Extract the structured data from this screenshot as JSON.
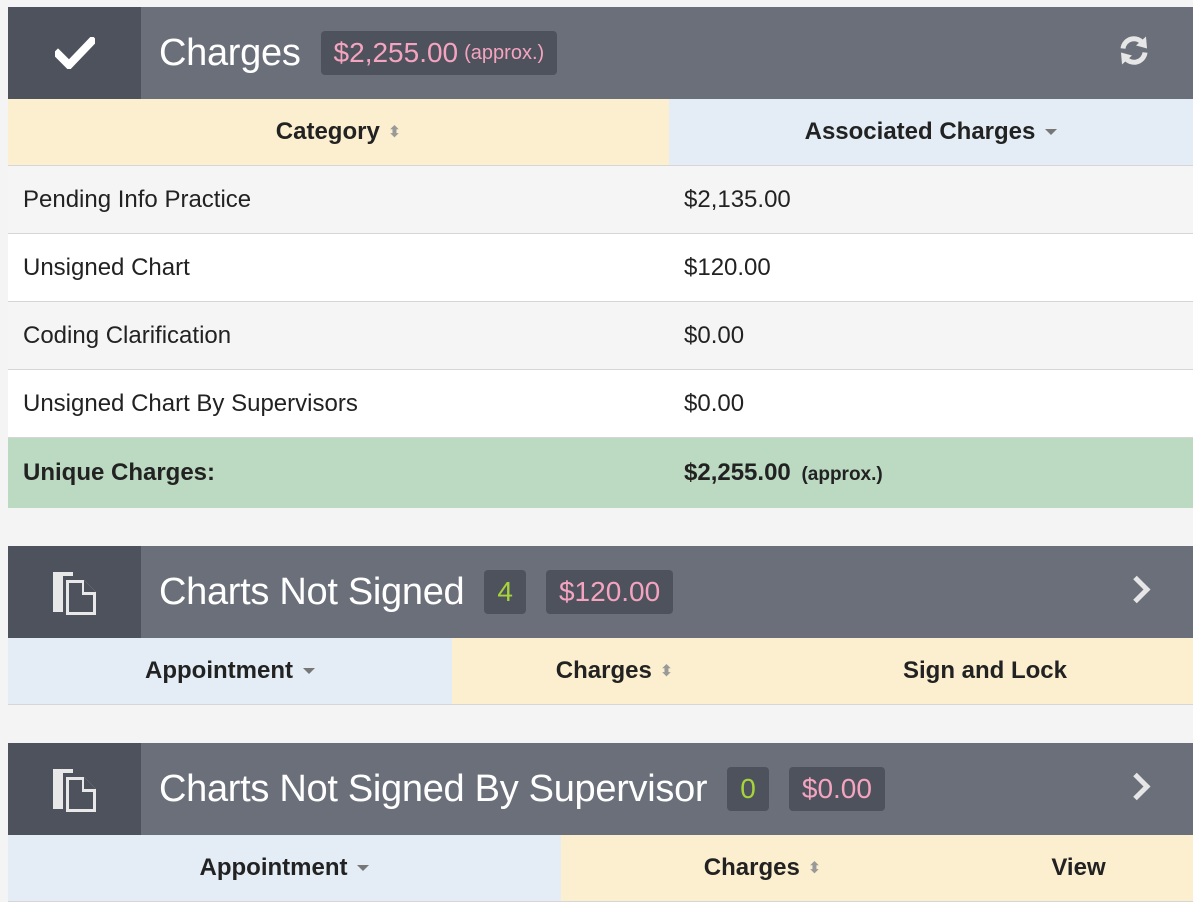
{
  "charges_panel": {
    "title": "Charges",
    "badge_amount": "$2,255.00",
    "badge_approx": "(approx.)",
    "col_category": "Category",
    "col_associated": "Associated Charges",
    "rows": [
      {
        "category": "Pending Info Practice",
        "amount": "$2,135.00"
      },
      {
        "category": "Unsigned Chart",
        "amount": "$120.00"
      },
      {
        "category": "Coding Clarification",
        "amount": "$0.00"
      },
      {
        "category": "Unsigned Chart By Supervisors",
        "amount": "$0.00"
      }
    ],
    "total_label": "Unique Charges:",
    "total_amount": "$2,255.00",
    "total_approx": "(approx.)"
  },
  "charts_not_signed": {
    "title": "Charts Not Signed",
    "count": "4",
    "amount": "$120.00",
    "col_appointment": "Appointment",
    "col_charges": "Charges",
    "col_action": "Sign and Lock"
  },
  "charts_not_signed_supervisor": {
    "title": "Charts Not Signed By Supervisor",
    "count": "0",
    "amount": "$0.00",
    "col_appointment": "Appointment",
    "col_charges": "Charges",
    "col_action": "View"
  },
  "icons": {
    "charges": "check-icon",
    "refresh": "refresh-icon",
    "documents": "documents-icon",
    "expand": "chevron-right-icon"
  }
}
